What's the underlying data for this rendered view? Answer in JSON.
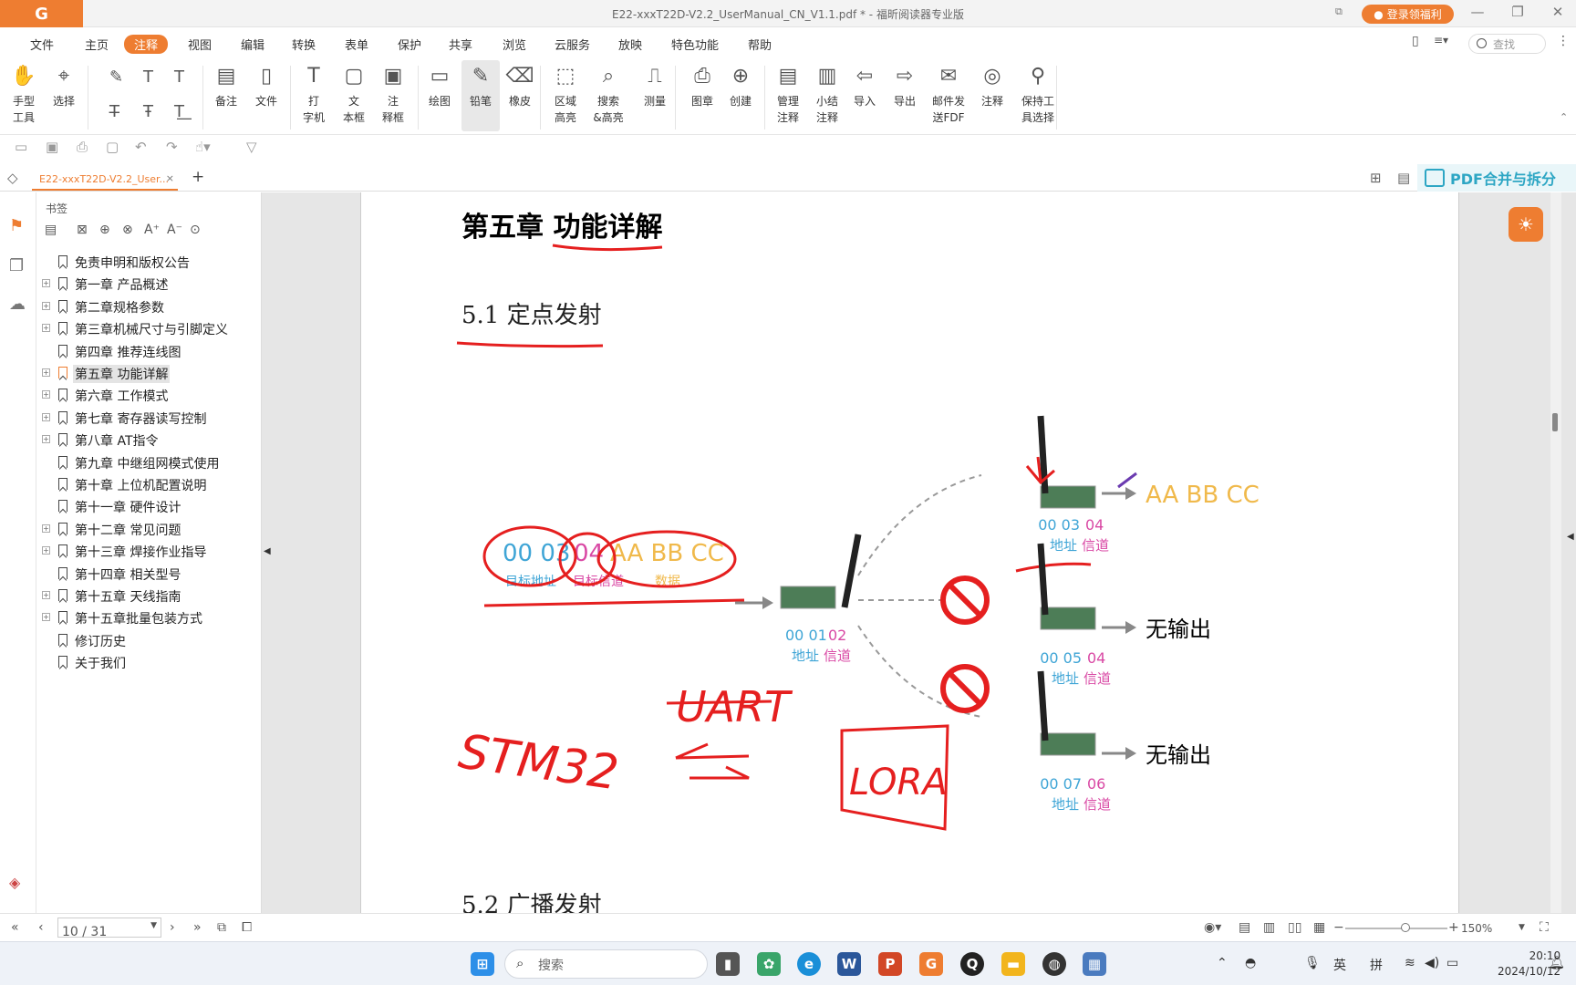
{
  "app": {
    "logo": "G",
    "title": "E22-xxxT22D-V2.2_UserManual_CN_V1.1.pdf * - 福昕阅读器专业版",
    "login": "登录领福利"
  },
  "menu": [
    "文件",
    "主页",
    "注释",
    "视图",
    "编辑",
    "转换",
    "表单",
    "保护",
    "共享",
    "浏览",
    "云服务",
    "放映",
    "特色功能",
    "帮助"
  ],
  "menu_active": "注释",
  "search": {
    "placeholder": "查找"
  },
  "ribbon": [
    {
      "l1": "手型",
      "l2": "工具",
      "icon": "hand-icon"
    },
    {
      "l1": "选择",
      "l2": "",
      "icon": "select-icon"
    },
    {
      "l1": "备注",
      "l2": "",
      "icon": "note-icon"
    },
    {
      "l1": "文件",
      "l2": "",
      "icon": "file-icon"
    },
    {
      "l1": "打",
      "l2": "字机",
      "icon": "typewriter-icon"
    },
    {
      "l1": "文",
      "l2": "本框",
      "icon": "textbox-icon"
    },
    {
      "l1": "注",
      "l2": "释框",
      "icon": "callout-icon"
    },
    {
      "l1": "绘图",
      "l2": "",
      "icon": "draw-icon"
    },
    {
      "l1": "铅笔",
      "l2": "",
      "icon": "pencil-icon"
    },
    {
      "l1": "橡皮",
      "l2": "",
      "icon": "eraser-icon"
    },
    {
      "l1": "区域",
      "l2": "高亮",
      "icon": "area-highlight-icon"
    },
    {
      "l1": "搜索",
      "l2": "&高亮",
      "icon": "search-highlight-icon"
    },
    {
      "l1": "测量",
      "l2": "",
      "icon": "measure-icon"
    },
    {
      "l1": "图章",
      "l2": "",
      "icon": "stamp-icon"
    },
    {
      "l1": "创建",
      "l2": "",
      "icon": "create-icon"
    },
    {
      "l1": "管理",
      "l2": "注释",
      "icon": "manage-icon"
    },
    {
      "l1": "小结",
      "l2": "注释",
      "icon": "summary-icon"
    },
    {
      "l1": "导入",
      "l2": "",
      "icon": "import-icon"
    },
    {
      "l1": "导出",
      "l2": "",
      "icon": "export-icon"
    },
    {
      "l1": "邮件发",
      "l2": "送FDF",
      "icon": "mail-icon"
    },
    {
      "l1": "注释",
      "l2": "",
      "icon": "comment-icon"
    },
    {
      "l1": "保持工",
      "l2": "具选择",
      "icon": "keep-tool-icon"
    }
  ],
  "tab": {
    "name": "E22-xxxT22D-V2.2_User...",
    "add": "+"
  },
  "promo": "PDF合并与拆分",
  "panel_title": "书签",
  "bookmarks": [
    {
      "label": "免责申明和版权公告",
      "exp": false
    },
    {
      "label": "第一章 产品概述",
      "exp": true
    },
    {
      "label": "第二章规格参数",
      "exp": true
    },
    {
      "label": "第三章机械尺寸与引脚定义",
      "exp": true
    },
    {
      "label": "第四章 推荐连线图",
      "exp": false
    },
    {
      "label": "第五章 功能详解",
      "exp": true,
      "current": true
    },
    {
      "label": "第六章 工作模式",
      "exp": true
    },
    {
      "label": "第七章 寄存器读写控制",
      "exp": true
    },
    {
      "label": "第八章 AT指令",
      "exp": true
    },
    {
      "label": "第九章 中继组网模式使用",
      "exp": false
    },
    {
      "label": "第十章 上位机配置说明",
      "exp": false
    },
    {
      "label": "第十一章 硬件设计",
      "exp": false
    },
    {
      "label": "第十二章 常见问题",
      "exp": true
    },
    {
      "label": "第十三章 焊接作业指导",
      "exp": true
    },
    {
      "label": "第十四章 相关型号",
      "exp": false
    },
    {
      "label": "第十五章 天线指南",
      "exp": true
    },
    {
      "label": "第十五章批量包装方式",
      "exp": true
    },
    {
      "label": "修订历史",
      "exp": false
    },
    {
      "label": "关于我们",
      "exp": false
    }
  ],
  "doc": {
    "chapter": "第五章  功能详解",
    "section": "5.1 定点发射",
    "next_section": "5.2 广播发射",
    "src": {
      "addr_hi": "00 03",
      "ch": "04",
      "data": "AA BB CC",
      "lbl_addr": "目标地址",
      "lbl_ch": "目标信道",
      "lbl_data": "数据"
    },
    "sender": {
      "addr": "00 01",
      "ch": "02",
      "lbl_addr": "地址",
      "lbl_ch": "信道"
    },
    "rx": [
      {
        "addr": "00 03",
        "ch": "04",
        "output": "AA BB CC"
      },
      {
        "addr": "00 05",
        "ch": "04",
        "output": "无输出"
      },
      {
        "addr": "00 07",
        "ch": "06",
        "output": "无输出"
      }
    ],
    "rx_lbl_addr": "地址",
    "rx_lbl_ch": "信道",
    "handwriting": {
      "left": "STM32",
      "top": "UART",
      "box": "LORA"
    }
  },
  "status": {
    "page": "10 / 31",
    "zoom": "150%"
  },
  "taskbar": {
    "search": "搜索",
    "ime1": "英",
    "ime2": "拼",
    "time": "20:10",
    "date": "2024/10/12"
  }
}
